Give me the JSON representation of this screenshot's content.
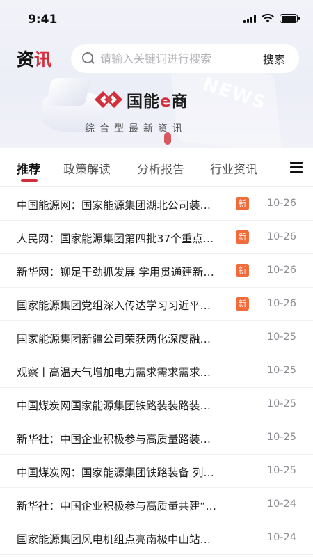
{
  "status_bar": {
    "time": "9:41"
  },
  "header": {
    "title_main": "资",
    "title_accent": "讯",
    "search_placeholder": "请输入关键词进行搜索",
    "search_button": "搜索"
  },
  "brand": {
    "name_prefix": "国能",
    "name_e": "e",
    "name_suffix": "商",
    "slogan": "综合型最新资讯",
    "decor_text": "NEWS"
  },
  "tabs": [
    {
      "label": "推荐",
      "active": true
    },
    {
      "label": "政策解读",
      "active": false
    },
    {
      "label": "分析报告",
      "active": false
    },
    {
      "label": "行业资讯",
      "active": false
    }
  ],
  "colors": {
    "accent": "#d12f3a",
    "badge": "#f26b3a",
    "date": "#8c8c92"
  },
  "news": [
    {
      "title": "中国能源网：国家能源集团湖北公司装…",
      "badge": "新",
      "date": "10-26"
    },
    {
      "title": "人民网：国家能源集团第四批37个重点…",
      "badge": "新",
      "date": "10-26"
    },
    {
      "title": "新华网：铆足干劲抓发展 学用贯通建新…",
      "badge": "新",
      "date": "10-26"
    },
    {
      "title": "国家能源集团党组深入传达学习习近平…",
      "badge": "新",
      "date": "10-26"
    },
    {
      "title": "国家能源集团新疆公司荣获两化深度融…",
      "badge": "",
      "date": "10-25"
    },
    {
      "title": "观察丨高温天气增加电力需求需求需求…",
      "badge": "",
      "date": "10-25"
    },
    {
      "title": "中国煤炭网国家能源集团铁路装装路装…",
      "badge": "",
      "date": "10-25"
    },
    {
      "title": "新华社：中国企业积极参与高质量路装…",
      "badge": "",
      "date": "10-25"
    },
    {
      "title": "中国煤炭网：国家能源集团铁路装备 列…",
      "badge": "",
      "date": "10-25"
    },
    {
      "title": "新华社：中国企业积极参与高质量共建“…",
      "badge": "",
      "date": "10-24"
    },
    {
      "title": "国家能源集团风电机组点亮南极中山站…",
      "badge": "",
      "date": "10-24"
    }
  ]
}
